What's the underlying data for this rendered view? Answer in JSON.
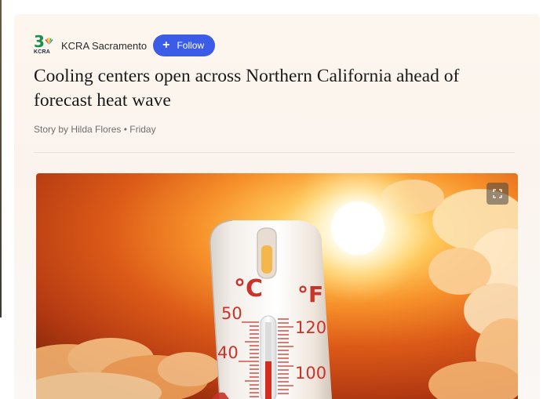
{
  "source": {
    "logo_icon": "kcra-3-nbc-logo",
    "logo_number": "3",
    "logo_call_sign": "KCRA",
    "name": "KCRA Sacramento",
    "follow_label": "Follow",
    "follow_icon": "plus-icon",
    "brand_color": "#3a5ce6"
  },
  "article": {
    "headline": "Cooling centers open across Northern California ahead of forecast heat wave",
    "byline": "Story by Hilda Flores • Friday"
  },
  "hero_image": {
    "subject": "thermometer-against-blazing-sun",
    "expand_icon": "expand-icon",
    "thermometer": {
      "celsius_unit": "°C",
      "fahrenheit_unit": "°F",
      "celsius_ticks": [
        "50",
        "40"
      ],
      "fahrenheit_ticks": [
        "120",
        "100"
      ]
    }
  }
}
